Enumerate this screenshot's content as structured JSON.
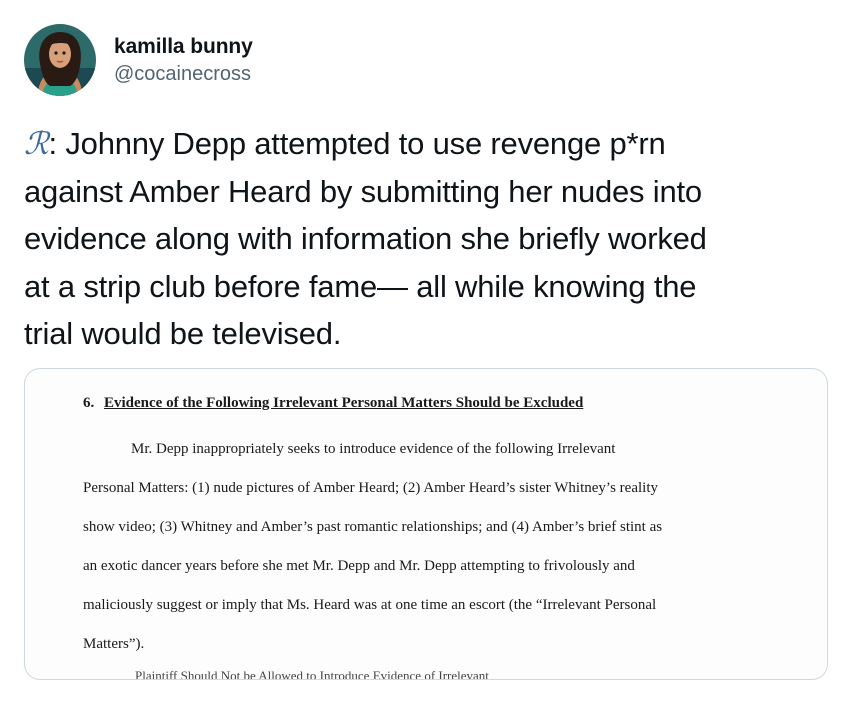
{
  "user": {
    "display_name": "kamilla bunny",
    "handle": "@cocainecross"
  },
  "tweet": {
    "glyph": "ℛ",
    "line1": ": Johnny Depp attempted to use revenge p*rn",
    "line2": "against Amber Heard by submitting her nudes into",
    "line3": "evidence along with information she briefly worked",
    "line4": "at a strip club before fame— all while knowing the",
    "line5": "trial would be televised."
  },
  "document": {
    "section_number": "6.",
    "section_title": "Evidence of the Following Irrelevant Personal Matters Should be Excluded",
    "lines": [
      "Mr. Depp inappropriately seeks to introduce evidence of the following Irrelevant",
      "Personal Matters: (1) nude pictures of Amber Heard; (2) Amber Heard’s sister Whitney’s reality",
      "show video; (3) Whitney and Amber’s past romantic relationships; and (4) Amber’s brief stint as",
      "an exotic dancer years before she met Mr. Depp and Mr. Depp attempting to frivolously and",
      "maliciously suggest or imply that Ms. Heard was at one time an escort (the “Irrelevant Personal",
      "Matters”)."
    ],
    "cut_off_line": "Plaintiff Should Not be Allowed to Introduce Evidence of Irrelevant"
  },
  "colors": {
    "text": "#0f1419",
    "secondary": "#536471",
    "border": "#cfd9de",
    "glyph": "#3b6aa0"
  }
}
